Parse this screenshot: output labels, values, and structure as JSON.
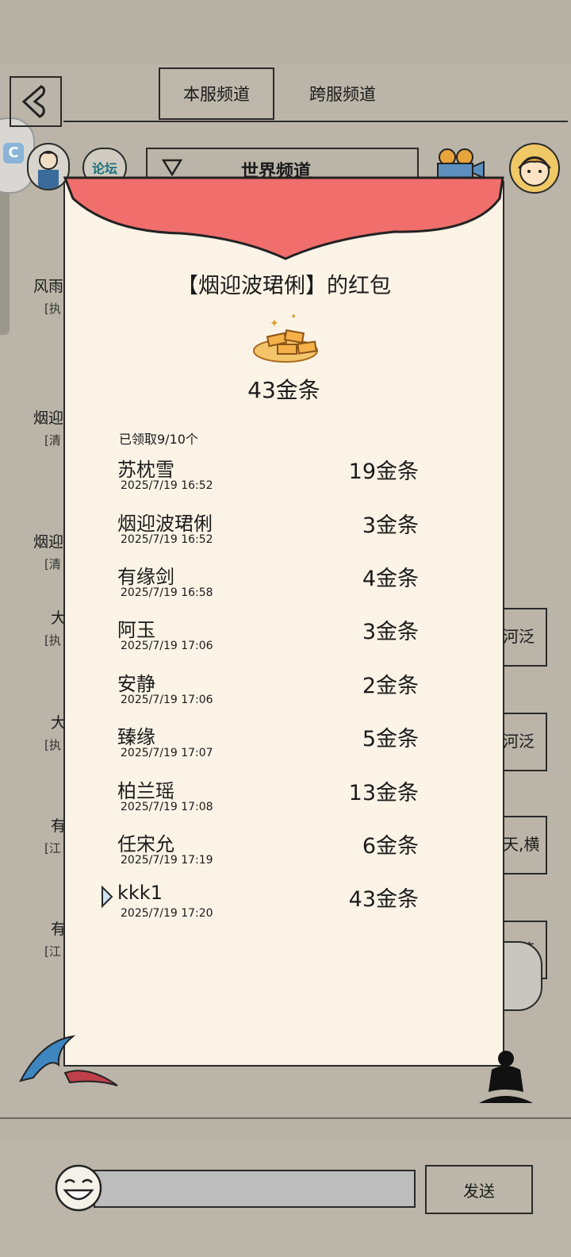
{
  "header": {
    "tab_local": "本服频道",
    "tab_cross": "跨服频道",
    "forum_label": "论坛",
    "world_channel": "世界频道",
    "side_widget_icon": "C"
  },
  "background": {
    "messages": [
      {
        "name": "风雨",
        "tag": "[执"
      },
      {
        "name": "烟迎",
        "tag": "[清"
      },
      {
        "name": "烟迎",
        "tag": "[清"
      },
      {
        "name": "大",
        "tag": "[执"
      },
      {
        "name": "大",
        "tag": "[执"
      },
      {
        "name": "有",
        "tag": "[江"
      },
      {
        "name": "有",
        "tag": "[江"
      }
    ],
    "right_snippets": [
      "河泛",
      "河泛",
      "天,横",
      "汪跨"
    ]
  },
  "red_packet": {
    "title": "【烟迎波珺俐】的红包",
    "total": "43金条",
    "claimed": "已领取9/10个",
    "flap_color": "#f06e6c",
    "entries": [
      {
        "name": "苏枕雪",
        "time": "2025/7/19 16:52",
        "amount": "19金条"
      },
      {
        "name": "烟迎波珺俐",
        "time": "2025/7/19 16:52",
        "amount": "3金条"
      },
      {
        "name": "有缘剑",
        "time": "2025/7/19 16:58",
        "amount": "4金条"
      },
      {
        "name": "阿玉",
        "time": "2025/7/19 17:06",
        "amount": "3金条"
      },
      {
        "name": "安静",
        "time": "2025/7/19 17:06",
        "amount": "2金条"
      },
      {
        "name": "臻缘",
        "time": "2025/7/19 17:07",
        "amount": "5金条"
      },
      {
        "name": "柏兰瑶",
        "time": "2025/7/19 17:08",
        "amount": "13金条"
      },
      {
        "name": "任宋允",
        "time": "2025/7/19 17:19",
        "amount": "6金条"
      },
      {
        "name": "kkk1",
        "time": "2025/7/19 17:20",
        "amount": "43金条"
      }
    ]
  },
  "footer": {
    "input_placeholder": "",
    "send_label": "发送",
    "emoji_icon": "laughing-face-icon"
  }
}
